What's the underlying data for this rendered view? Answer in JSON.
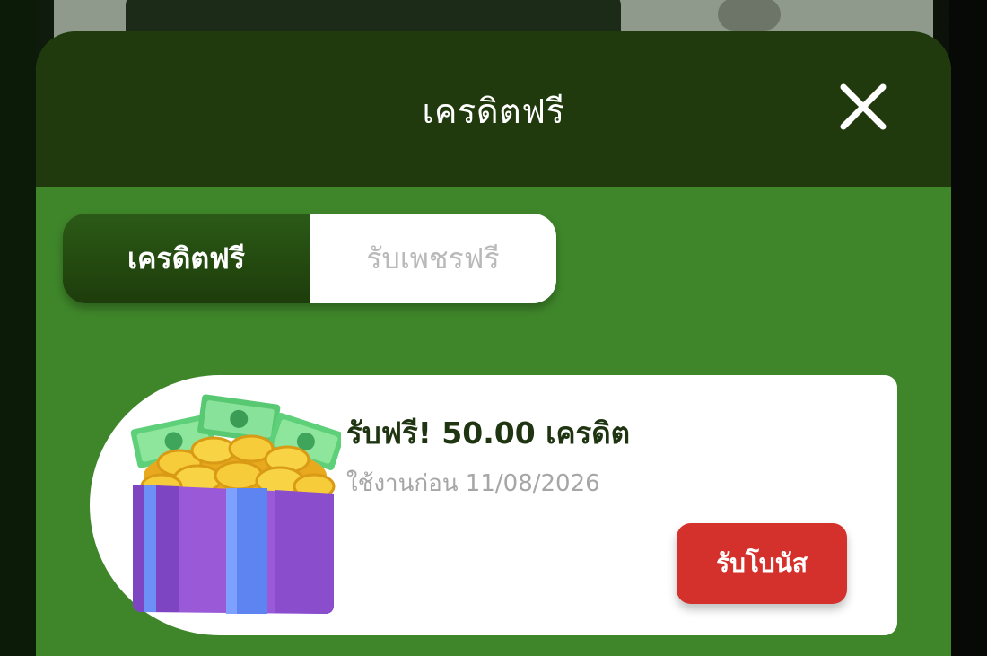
{
  "modal": {
    "title": "เครดิตฟรี"
  },
  "tabs": [
    {
      "label": "เครดิตฟรี",
      "active": true
    },
    {
      "label": "รับเพชรฟรี",
      "active": false
    }
  ],
  "reward": {
    "title": "รับฟรี! 50.00 เครดิต",
    "expiry": "ใช้งานก่อน 11/08/2026",
    "claim_label": "รับโบนัส",
    "icon": "gift-box-with-coins-icon"
  },
  "colors": {
    "header_bg": "#203a0e",
    "body_bg": "#3f862a",
    "tab_active_bg": "#23480f",
    "claim_button": "#d4312d"
  }
}
